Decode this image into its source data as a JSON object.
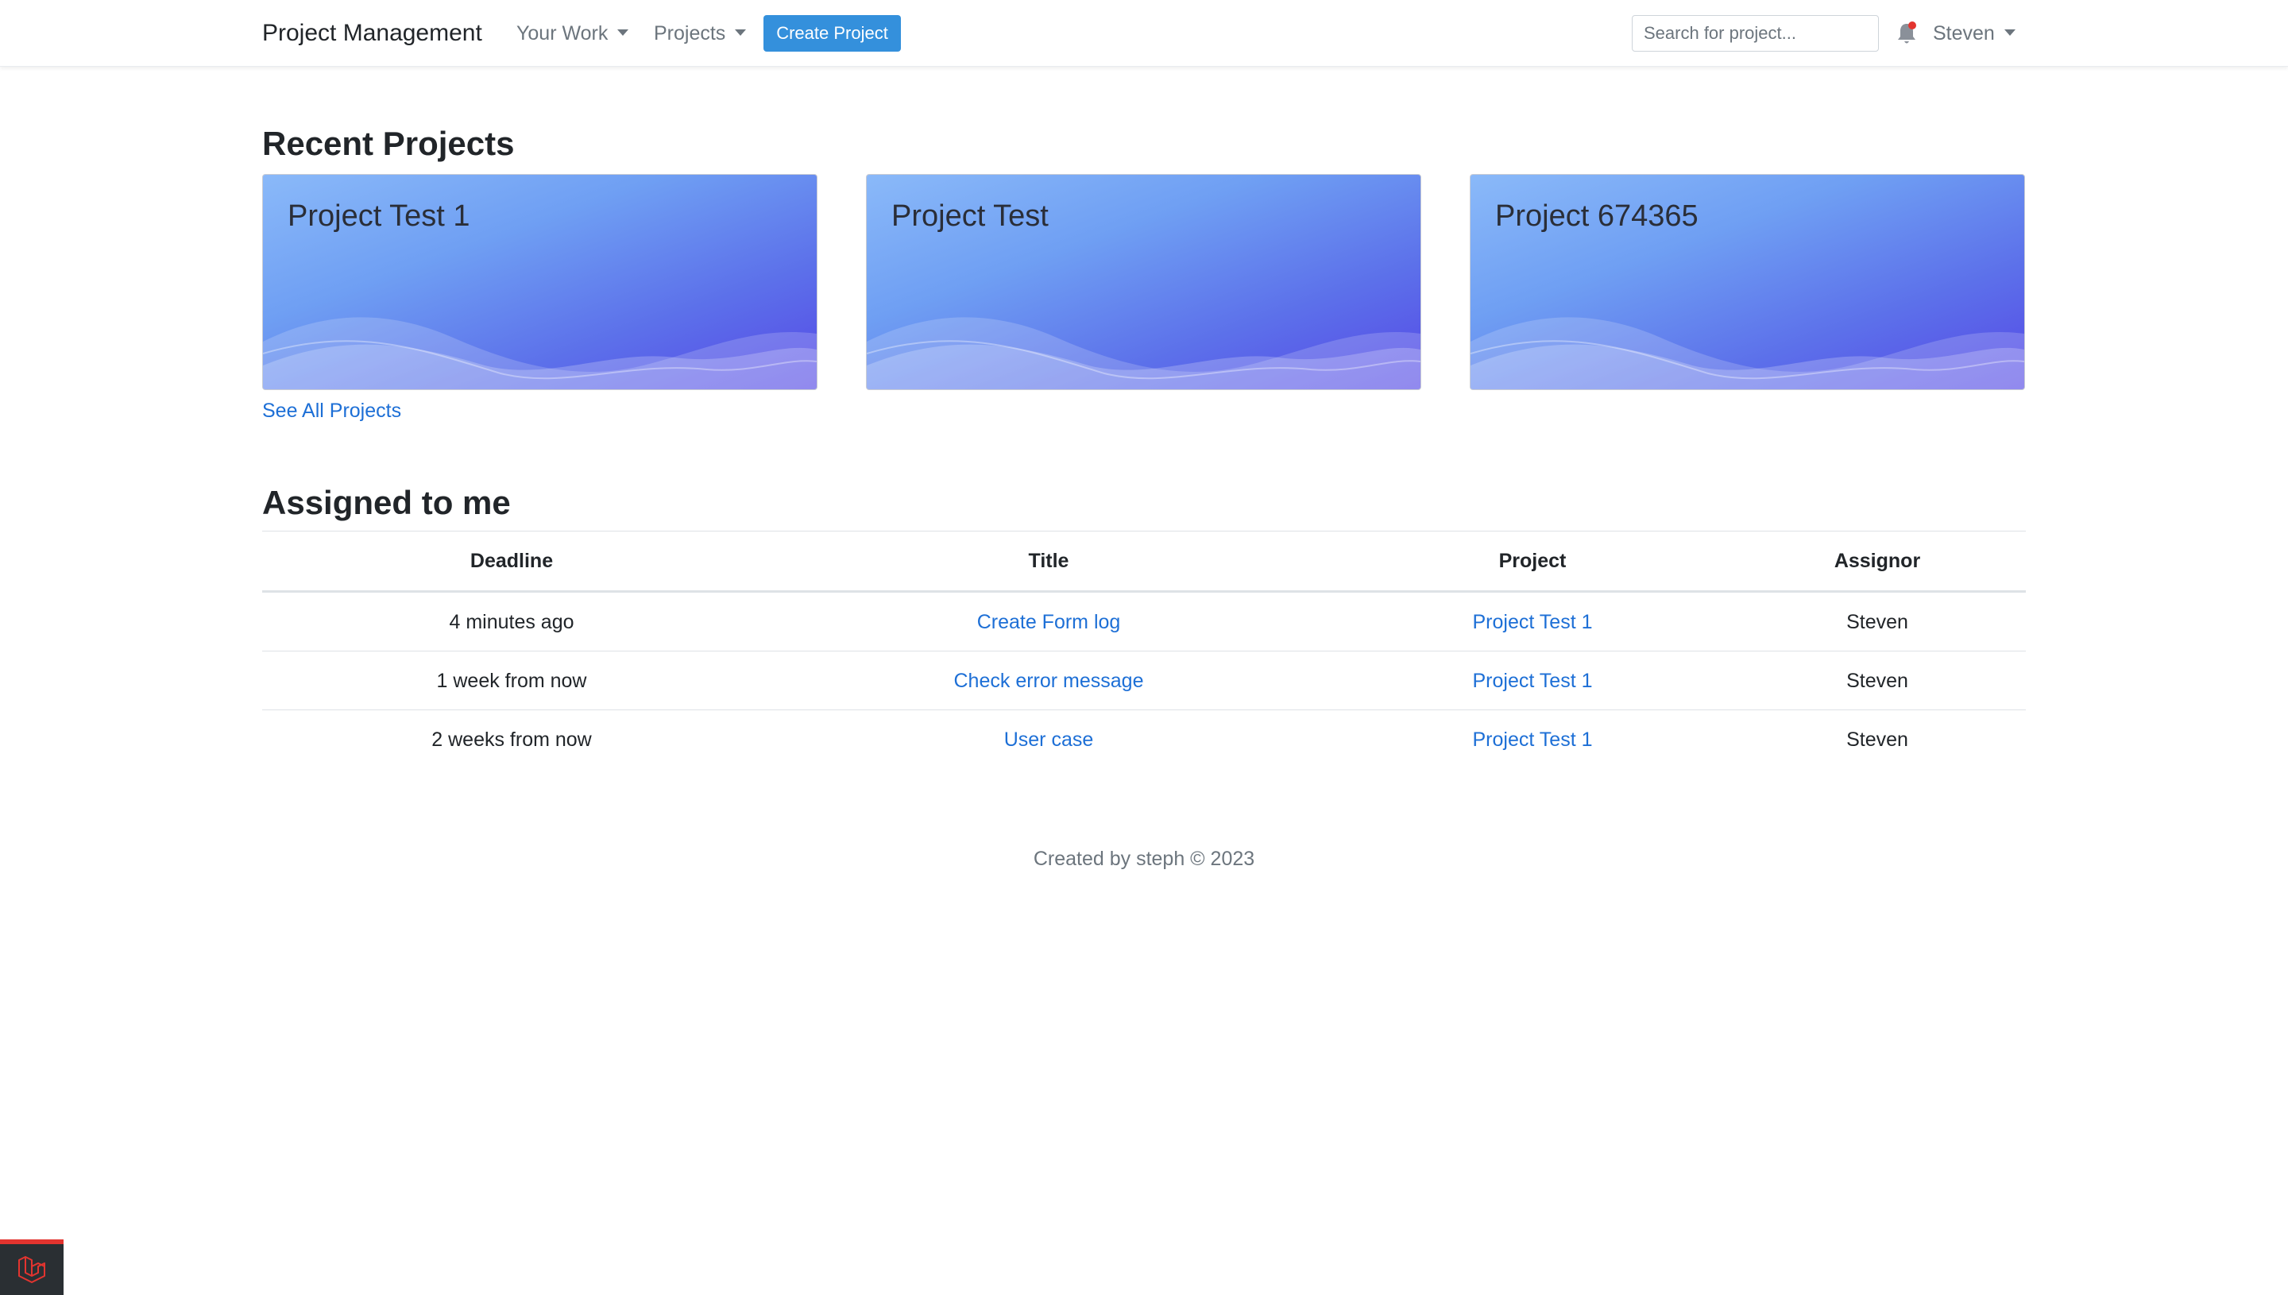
{
  "navbar": {
    "brand": "Project Management",
    "your_work": "Your Work",
    "projects": "Projects",
    "create_button": "Create Project",
    "search_placeholder": "Search for project...",
    "user_name": "Steven",
    "notification_dot_color": "#e3342f"
  },
  "recent": {
    "heading": "Recent Projects",
    "cards": [
      {
        "title": "Project Test 1"
      },
      {
        "title": "Project Test"
      },
      {
        "title": "Project 674365"
      }
    ],
    "see_all": "See All Projects"
  },
  "assigned": {
    "heading": "Assigned to me",
    "columns": [
      "Deadline",
      "Title",
      "Project",
      "Assignor"
    ],
    "rows": [
      {
        "deadline": "4 minutes ago",
        "title": "Create Form log",
        "project": "Project Test 1",
        "assignor": "Steven"
      },
      {
        "deadline": "1 week from now",
        "title": "Check error message",
        "project": "Project Test 1",
        "assignor": "Steven"
      },
      {
        "deadline": "2 weeks from now",
        "title": "User case",
        "project": "Project Test 1",
        "assignor": "Steven"
      }
    ]
  },
  "footer": "Created by steph © 2023",
  "colors": {
    "primary": "#3490dc",
    "link": "#1d6fd6",
    "card_gradient_start": "#8ab9f9",
    "card_gradient_end": "#5548e6"
  },
  "icons": [
    "bell-icon",
    "caret-down-icon",
    "laravel-logo-icon"
  ]
}
